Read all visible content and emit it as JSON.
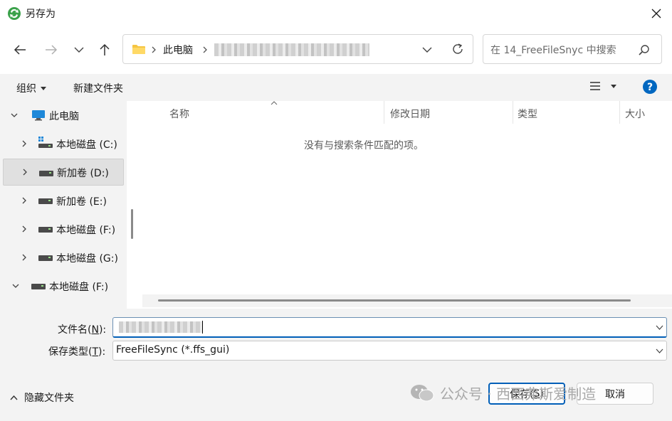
{
  "window": {
    "title": "另存为"
  },
  "nav": {
    "address": {
      "root": "此电脑"
    },
    "search": {
      "placeholder": "在 14_FreeFileSnyc 中搜索"
    }
  },
  "toolbar": {
    "organize": "组织",
    "new_folder": "新建文件夹"
  },
  "tree": {
    "items": [
      {
        "label": "此电脑",
        "icon": "monitor-icon"
      },
      {
        "label": "本地磁盘 (C:)",
        "icon": "windows-drive-icon"
      },
      {
        "label": "新加卷 (D:)",
        "icon": "drive-icon",
        "selected": true
      },
      {
        "label": "新加卷 (E:)",
        "icon": "drive-icon"
      },
      {
        "label": "本地磁盘 (F:)",
        "icon": "drive-icon"
      },
      {
        "label": "本地磁盘 (G:)",
        "icon": "drive-icon"
      },
      {
        "label": "本地磁盘 (F:)",
        "icon": "drive-icon"
      }
    ]
  },
  "columns": {
    "name": "名称",
    "modified": "修改日期",
    "type": "类型",
    "size": "大小"
  },
  "content": {
    "empty_message": "没有与搜索条件匹配的项。"
  },
  "form": {
    "filename_label_pre": "文件名(",
    "filename_label_key": "N",
    "filename_label_post": "):",
    "filetype_label_pre": "保存类型(",
    "filetype_label_key": "T",
    "filetype_label_post": "):",
    "filetype_value": "FreeFileSync (*.ffs_gui)"
  },
  "footer": {
    "hide_folders": "隐藏文件夹",
    "save_pre": "保存(",
    "save_key": "S",
    "save_post": ")",
    "cancel": "取消"
  },
  "watermark": {
    "text": "公众号 · 西西弗斯爱制造"
  },
  "colors": {
    "accent": "#005fb8",
    "help": "#0067c0",
    "folder": "#f5c542",
    "monitor": "#1e88d9"
  }
}
